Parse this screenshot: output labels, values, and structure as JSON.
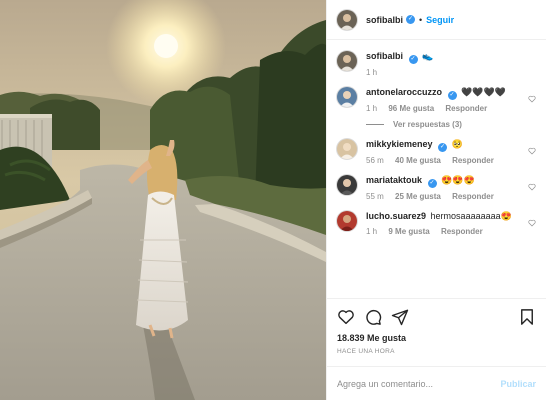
{
  "post": {
    "username": "sofibalbi",
    "follow_label": "Seguir",
    "separator": "•",
    "caption": {
      "username": "sofibalbi",
      "emoji": "👟",
      "time": "1 h"
    },
    "comments": [
      {
        "username": "antonelaroccuzzo",
        "verified": true,
        "text": "🖤🖤🖤🖤",
        "time": "1 h",
        "likes": "96 Me gusta",
        "reply": "Responder",
        "avatar_color": "#5b7fa3"
      },
      {
        "username": "mikkykiemeney",
        "verified": true,
        "text": "🥺",
        "time": "56 m",
        "likes": "40 Me gusta",
        "reply": "Responder",
        "avatar_color": "#d8c3a2"
      },
      {
        "username": "mariataktouk",
        "verified": true,
        "text": "😍😍😍",
        "time": "55 m",
        "likes": "25 Me gusta",
        "reply": "Responder",
        "avatar_color": "#3a3a3a"
      },
      {
        "username": "lucho.suarez9",
        "verified": false,
        "text": "hermosaaaaaaaa😍",
        "time": "1 h",
        "likes": "9 Me gusta",
        "reply": "Responder",
        "avatar_color": "#b23a2e"
      }
    ],
    "view_replies": "Ver respuestas (3)",
    "likes_count": "18.839 Me gusta",
    "posted_ago": "HACE UNA HORA",
    "comment_placeholder": "Agrega un comentario...",
    "publish_label": "Publicar"
  },
  "colors": {
    "accent": "#0095f6",
    "verified": "#3897f0",
    "muted": "#8e8e8e",
    "publish_disabled": "#b2dffc"
  }
}
